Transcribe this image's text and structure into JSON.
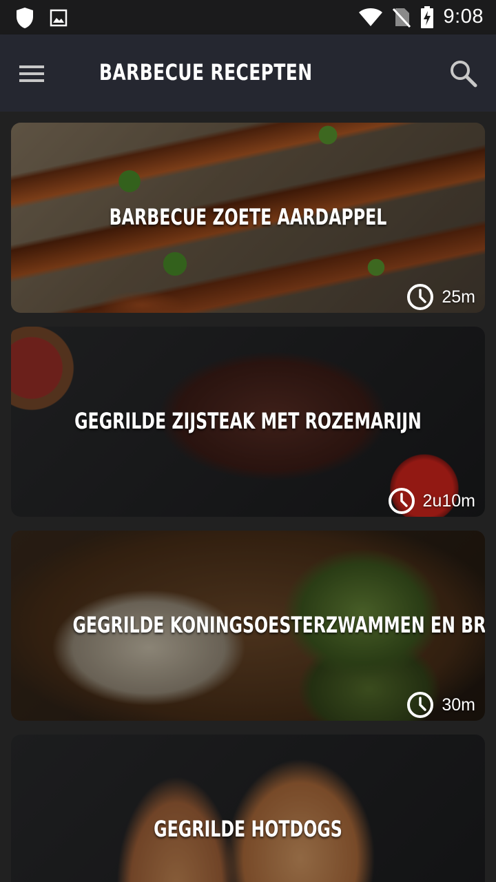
{
  "status_bar": {
    "time": "9:08",
    "icons": [
      "shield-icon",
      "image-icon",
      "wifi-icon",
      "no-sim-icon",
      "battery-charging-icon"
    ]
  },
  "app_bar": {
    "title": "BARBECUE RECEPTEN",
    "menu_icon": "hamburger-menu-icon",
    "search_icon": "search-icon"
  },
  "recipes": [
    {
      "title": "BARBECUE ZOETE AARDAPPEL",
      "time": "25m"
    },
    {
      "title": "GEGRILDE ZIJSTEAK MET ROZEMARIJN",
      "time": "2u10m"
    },
    {
      "title": "GEGRILDE KONINGSOESTERZWAMMEN EN BROCCOLI",
      "time": "30m"
    },
    {
      "title": "GEGRILDE HOTDOGS",
      "time": ""
    }
  ]
}
